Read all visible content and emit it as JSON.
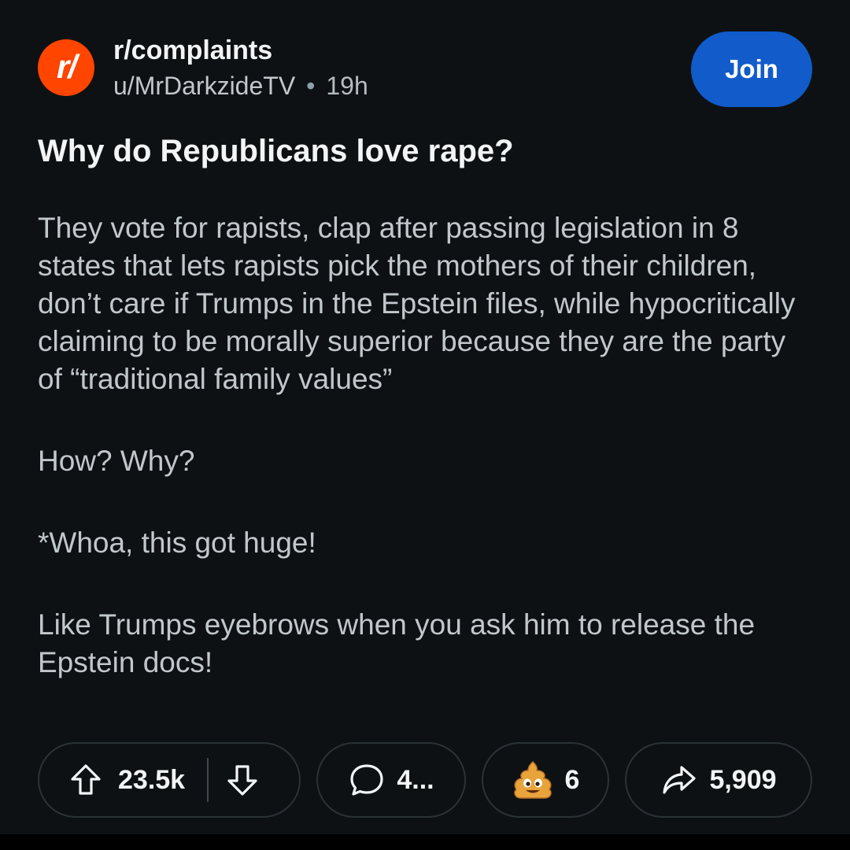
{
  "post": {
    "subreddit": "r/complaints",
    "avatar_glyph": "r/",
    "author": "u/MrDarkzideTV",
    "separator": "•",
    "age": "19h",
    "join_label": "Join",
    "title": "Why do Republicans love rape?",
    "body": [
      "They vote for rapists, clap after passing legislation in 8 states that lets rapists pick the mothers of their children, don’t care if Trumps in the Epstein files, while hypocritically claiming to be morally superior because they are the party of “traditional family values”",
      "How? Why?",
      "*Whoa, this got huge!",
      "Like Trumps eyebrows when you ask him to release the Epstein docs!"
    ]
  },
  "actions": {
    "upvotes": "23.5k",
    "comments": "4...",
    "awards": "6",
    "shares": "5,909"
  },
  "colors": {
    "background": "#0e1113",
    "avatar": "#ff4500",
    "join_button": "#115bca",
    "text_primary": "#f2f4f5",
    "text_secondary": "#c1c8cc"
  },
  "icons": {
    "upvote": "arrow-up-icon",
    "downvote": "arrow-down-icon",
    "comment": "speech-bubble-icon",
    "award": "poop-emoji-icon",
    "share": "share-arrow-icon"
  }
}
